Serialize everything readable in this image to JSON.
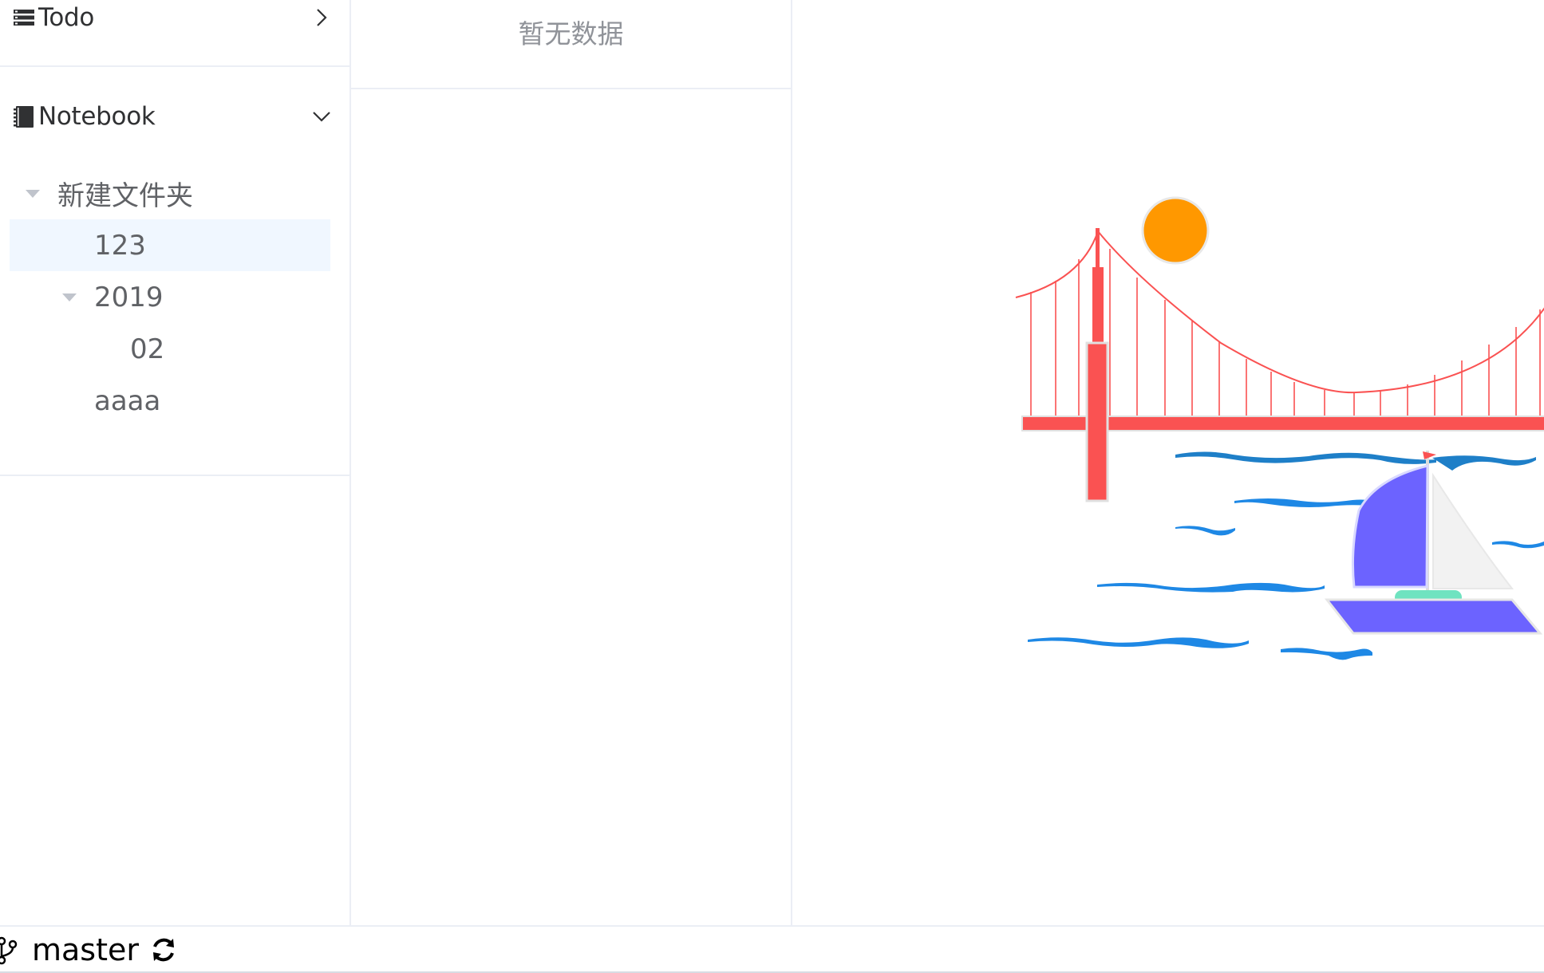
{
  "sidebar": {
    "todo": {
      "label": "Todo",
      "icon": "list-icon",
      "expanded": false
    },
    "notebook": {
      "label": "Notebook",
      "icon": "notebook-icon",
      "expanded": true
    },
    "tree": [
      {
        "label": "新建文件夹",
        "expanded": true
      },
      {
        "label": "123",
        "selected": true
      },
      {
        "label": "2019",
        "expanded": true
      },
      {
        "label": "02"
      },
      {
        "label": "aaaa"
      }
    ]
  },
  "list": {
    "empty_text": "暂无数据"
  },
  "statusbar": {
    "branch": "master",
    "branch_icon": "git-branch-icon",
    "sync_icon": "sync-icon"
  },
  "colors": {
    "bridge_red": "#fa5252",
    "sun_orange": "#ff9800",
    "sail_purple": "#6c63ff",
    "water_blue": "#1e88e5",
    "selected_bg": "#f0f7ff",
    "divider": "#ebeef5"
  }
}
